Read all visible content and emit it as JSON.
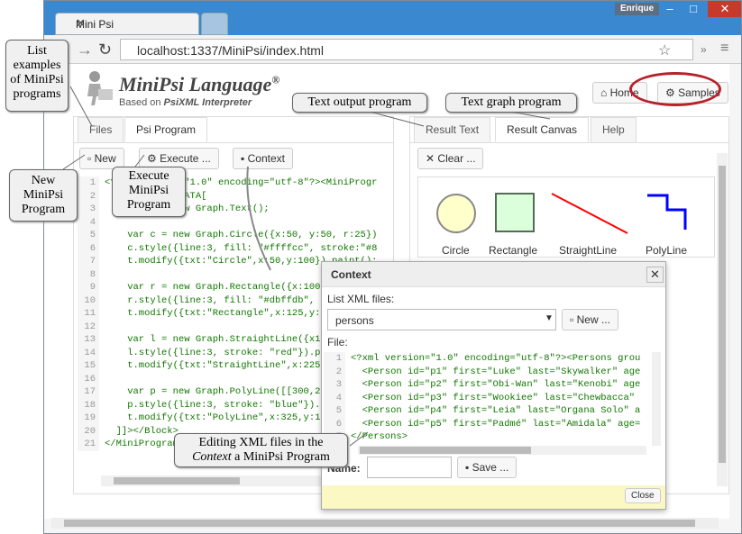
{
  "browser": {
    "tab_title": "Mini Psi",
    "url": "localhost:1337/MiniPsi/index.html",
    "user": "Enrique"
  },
  "header": {
    "title": "MiniPsi Language",
    "title_mark": "®",
    "subtitle_prefix": "Based on",
    "subtitle_brand": "PsiXML Interpreter",
    "home_label": "Home",
    "samples_label": "Samples"
  },
  "left": {
    "tabs": [
      "Files",
      "Psi Program"
    ],
    "new_label": "New",
    "execute_label": "Execute ...",
    "context_label": "Context",
    "code": [
      "<?xml version=\"1.0\" encoding=\"utf-8\"?><MiniProgr",
      "  <Block><![CDATA[",
      "    var t = new Graph.Text();",
      "",
      "    var c = new Graph.Circle({x:50, y:50, r:25})",
      "    c.style({line:3, fill: \"#ffffcc\", stroke:\"#8",
      "    t.modify({txt:\"Circle\",x:50,y:100}).paint();",
      "",
      "    var r = new Graph.Rectangle({x:100, y:25,",
      "    r.style({line:3, fill: \"#dbffdb\", stroke",
      "    t.modify({txt:\"Rectangle\",x:125,y:100}).",
      "",
      "    var l = new Graph.StraightLine({x1:175,",
      "    l.style({line:3, stroke: \"red\"}).paint()",
      "    t.modify({txt:\"StraightLine\",x:225,y:100",
      "",
      "    var p = new Graph.PolyLine([[300,25],[32",
      "    p.style({line:3, stroke: \"blue\"}).paint(",
      "    t.modify({txt:\"PolyLine\",x:325,y:100}).pa",
      "  ]]></Block>",
      "</MiniProgram>"
    ]
  },
  "right": {
    "tabs": [
      "Result Text",
      "Result Canvas",
      "Help"
    ],
    "clear_label": "Clear ...",
    "shapes": [
      "Circle",
      "Rectangle",
      "StraightLine",
      "PolyLine"
    ]
  },
  "context": {
    "title": "Context",
    "list_label": "List XML files:",
    "selected_file": "persons",
    "new_label": "New ...",
    "file_label": "File:",
    "code": [
      "<?xml version=\"1.0\" encoding=\"utf-8\"?><Persons grou",
      "  <Person id=\"p1\" first=\"Luke\" last=\"Skywalker\" age",
      "  <Person id=\"p2\" first=\"Obi-Wan\" last=\"Kenobi\" age",
      "  <Person id=\"p3\" first=\"Wookiee\" last=\"Chewbacca\"",
      "  <Person id=\"p4\" first=\"Leia\" last=\"Organa Solo\" a",
      "  <Person id=\"p5\" first=\"Padmé\" last=\"Amidala\" age=",
      "</Persons>"
    ],
    "name_label": "Name:",
    "save_label": "Save ...",
    "close_label": "Close"
  },
  "callouts": {
    "list_examples": "List examples of MiniPsi programs",
    "text_output": "Text output program",
    "text_graph": "Text graph program",
    "new_program": "New MiniPsi Program",
    "execute_program": "Execute MiniPsi Program",
    "editing_xml_1": "Editing XML files in the",
    "editing_xml_2a": "Context",
    "editing_xml_2b": " a MiniPsi Program"
  },
  "colors": {
    "titlebar": "#3a88d0",
    "oval": "#b8202a",
    "circle_fill": "#ffffcc",
    "rect_fill": "#dbffdb",
    "line": "#ff0000",
    "polyline": "#0000ff"
  }
}
